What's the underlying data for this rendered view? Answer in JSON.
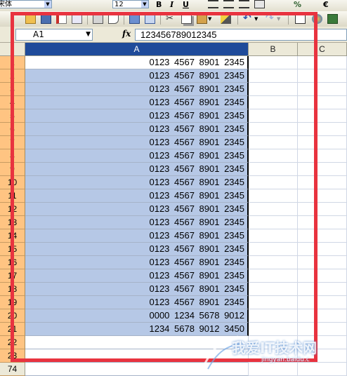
{
  "toolbar_format": {
    "font_name": "宋体",
    "font_size": "12",
    "bold_label": "B",
    "italic_label": "I",
    "underline_label": "U",
    "percent_label": "%",
    "currency_label": "€"
  },
  "formula_bar": {
    "name_box": "A1",
    "fx_label": "fx",
    "content": "123456789012345"
  },
  "columns": [
    "A",
    "B",
    "C"
  ],
  "rows": [
    {
      "num": "1",
      "a": "0123 4567 8901 2345"
    },
    {
      "num": "2",
      "a": "0123 4567 8901 2345"
    },
    {
      "num": "3",
      "a": "0123 4567 8901 2345"
    },
    {
      "num": "4",
      "a": "0123 4567 8901 2345"
    },
    {
      "num": "5",
      "a": "0123 4567 8901 2345"
    },
    {
      "num": "6",
      "a": "0123 4567 8901 2345"
    },
    {
      "num": "7",
      "a": "0123 4567 8901 2345"
    },
    {
      "num": "8",
      "a": "0123 4567 8901 2345"
    },
    {
      "num": "9",
      "a": "0123 4567 8901 2345"
    },
    {
      "num": "10",
      "a": "0123 4567 8901 2345"
    },
    {
      "num": "11",
      "a": "0123 4567 8901 2345"
    },
    {
      "num": "12",
      "a": "0123 4567 8901 2345"
    },
    {
      "num": "13",
      "a": "0123 4567 8901 2345"
    },
    {
      "num": "14",
      "a": "0123 4567 8901 2345"
    },
    {
      "num": "15",
      "a": "0123 4567 8901 2345"
    },
    {
      "num": "16",
      "a": "0123 4567 8901 2345"
    },
    {
      "num": "17",
      "a": "0123 4567 8901 2345"
    },
    {
      "num": "18",
      "a": "0123 4567 8901 2345"
    },
    {
      "num": "19",
      "a": "0123 4567 8901 2345"
    },
    {
      "num": "20",
      "a": "0000 1234 5678 9012"
    },
    {
      "num": "21",
      "a": "1234 5678 9012 3450"
    },
    {
      "num": "22",
      "a": ""
    },
    {
      "num": "23",
      "a": ""
    }
  ],
  "bottom_row_num": "74",
  "watermark": {
    "main": "我爱IT技术网",
    "sub": "jingyan.baidu.c"
  },
  "colors": {
    "highlight": "#e8333f",
    "selection": "#b6c8e6",
    "row_header": "#ffc482",
    "active_column_header": "#1f4b9a"
  }
}
